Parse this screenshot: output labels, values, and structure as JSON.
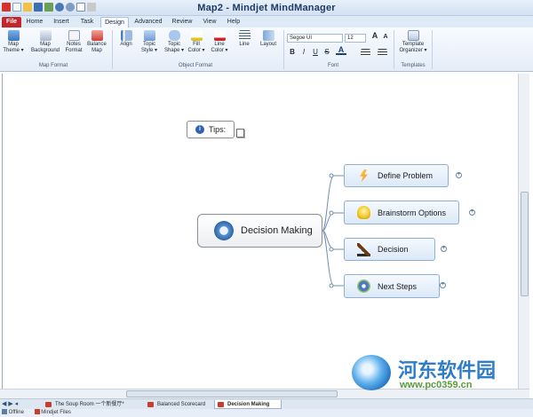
{
  "window": {
    "title": "Map2 - Mindjet MindManager"
  },
  "ribbon_tabs": [
    "File",
    "Home",
    "Insert",
    "Task",
    "Design",
    "Advanced",
    "Review",
    "View",
    "Help"
  ],
  "active_tab": "Design",
  "groups": {
    "map_format": {
      "label": "Map Format",
      "buttons": [
        "Map Theme ▾",
        "Map Background",
        "Notes Format",
        "Balance Map"
      ]
    },
    "object_format": {
      "label": "Object Format",
      "buttons": [
        "Align",
        "Topic Style ▾",
        "Topic Shape ▾",
        "Fill Color ▾",
        "Line Color ▾",
        "Line",
        "Layout"
      ]
    },
    "font": {
      "label": "Font",
      "family": "Segoe UI",
      "size": "12",
      "bold": "B",
      "italic": "I",
      "underline": "U",
      "strike": "S",
      "color": "A"
    },
    "templates": {
      "label": "Templates",
      "button": "Template Organizer ▾"
    }
  },
  "map": {
    "central_topic": "Decision Making",
    "tips": "Tips:",
    "subtopics": [
      "Define Problem",
      "Brainstorm Options",
      "Decision",
      "Next Steps"
    ]
  },
  "doc_tabs": [
    "The Soup Room 一个新餐厅*",
    "Balanced Scorecard",
    "Decision Making"
  ],
  "active_doc": "Decision Making",
  "status": {
    "mode": "Offline",
    "panel": "Mindjet Files"
  },
  "watermark": {
    "name": "河东软件园",
    "url": "www.pc0359.cn"
  },
  "colors": {
    "file_tab": "#c3262b",
    "ribbon_top": "#f8fbff",
    "topic_border": "#8fb0d6",
    "connector": "#6f8fb3"
  }
}
